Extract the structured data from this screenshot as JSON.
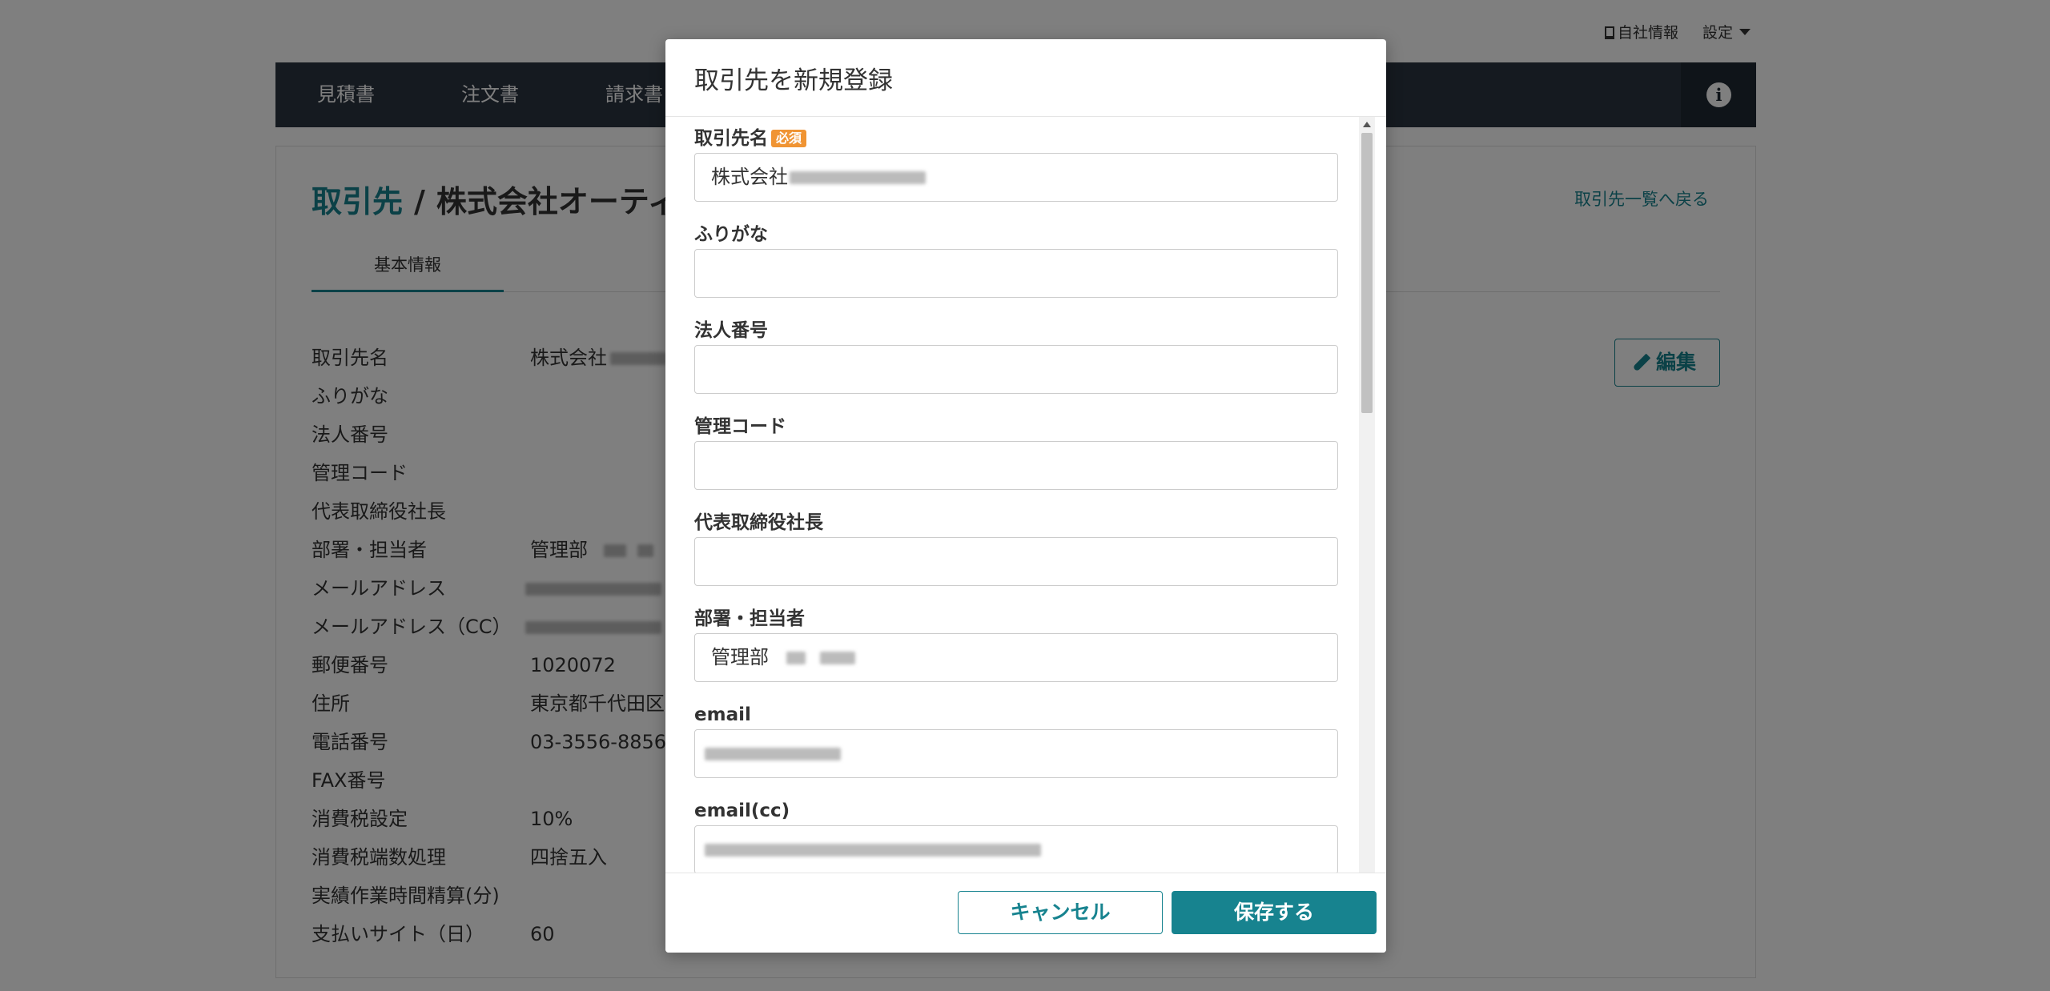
{
  "top": {
    "company_info": "自社情報",
    "settings": "設定"
  },
  "nav": {
    "items": [
      "見積書",
      "注文書",
      "請求書"
    ]
  },
  "page": {
    "breadcrumb_root": "取引先",
    "breadcrumb_sep": "/",
    "breadcrumb_current": "株式会社オーティ",
    "back_link": "取引先一覧へ戻る",
    "tab_basic": "基本情報",
    "edit_button": "編集"
  },
  "details": [
    {
      "label": "取引先名",
      "value": "株式会社"
    },
    {
      "label": "ふりがな",
      "value": ""
    },
    {
      "label": "法人番号",
      "value": ""
    },
    {
      "label": "管理コード",
      "value": ""
    },
    {
      "label": "代表取締役社長",
      "value": ""
    },
    {
      "label": "部署・担当者",
      "value": "管理部"
    },
    {
      "label": "メールアドレス",
      "value": ""
    },
    {
      "label": "メールアドレス（CC）",
      "value": ""
    },
    {
      "label": "郵便番号",
      "value": "1020072"
    },
    {
      "label": "住所",
      "value": "東京都千代田区"
    },
    {
      "label": "電話番号",
      "value": "03-3556-8856"
    },
    {
      "label": "FAX番号",
      "value": ""
    },
    {
      "label": "消費税設定",
      "value": "10%"
    },
    {
      "label": "消費税端数処理",
      "value": "四捨五入"
    },
    {
      "label": "実績作業時間精算(分)",
      "value": ""
    },
    {
      "label": "支払いサイト（日）",
      "value": "60"
    }
  ],
  "modal": {
    "title": "取引先を新規登録",
    "required_badge": "必須",
    "fields": [
      {
        "label": "取引先名",
        "value": "株式会社"
      },
      {
        "label": "ふりがな",
        "value": ""
      },
      {
        "label": "法人番号",
        "value": ""
      },
      {
        "label": "管理コード",
        "value": ""
      },
      {
        "label": "代表取締役社長",
        "value": ""
      },
      {
        "label": "部署・担当者",
        "value": "管理部"
      },
      {
        "label": "email",
        "value": ""
      },
      {
        "label": "email(cc)",
        "value": ""
      }
    ],
    "cancel_button": "キャンセル",
    "save_button": "保存する"
  },
  "colors": {
    "accent": "#17838f",
    "navbar": "#2b3440",
    "badge": "#f09433"
  }
}
